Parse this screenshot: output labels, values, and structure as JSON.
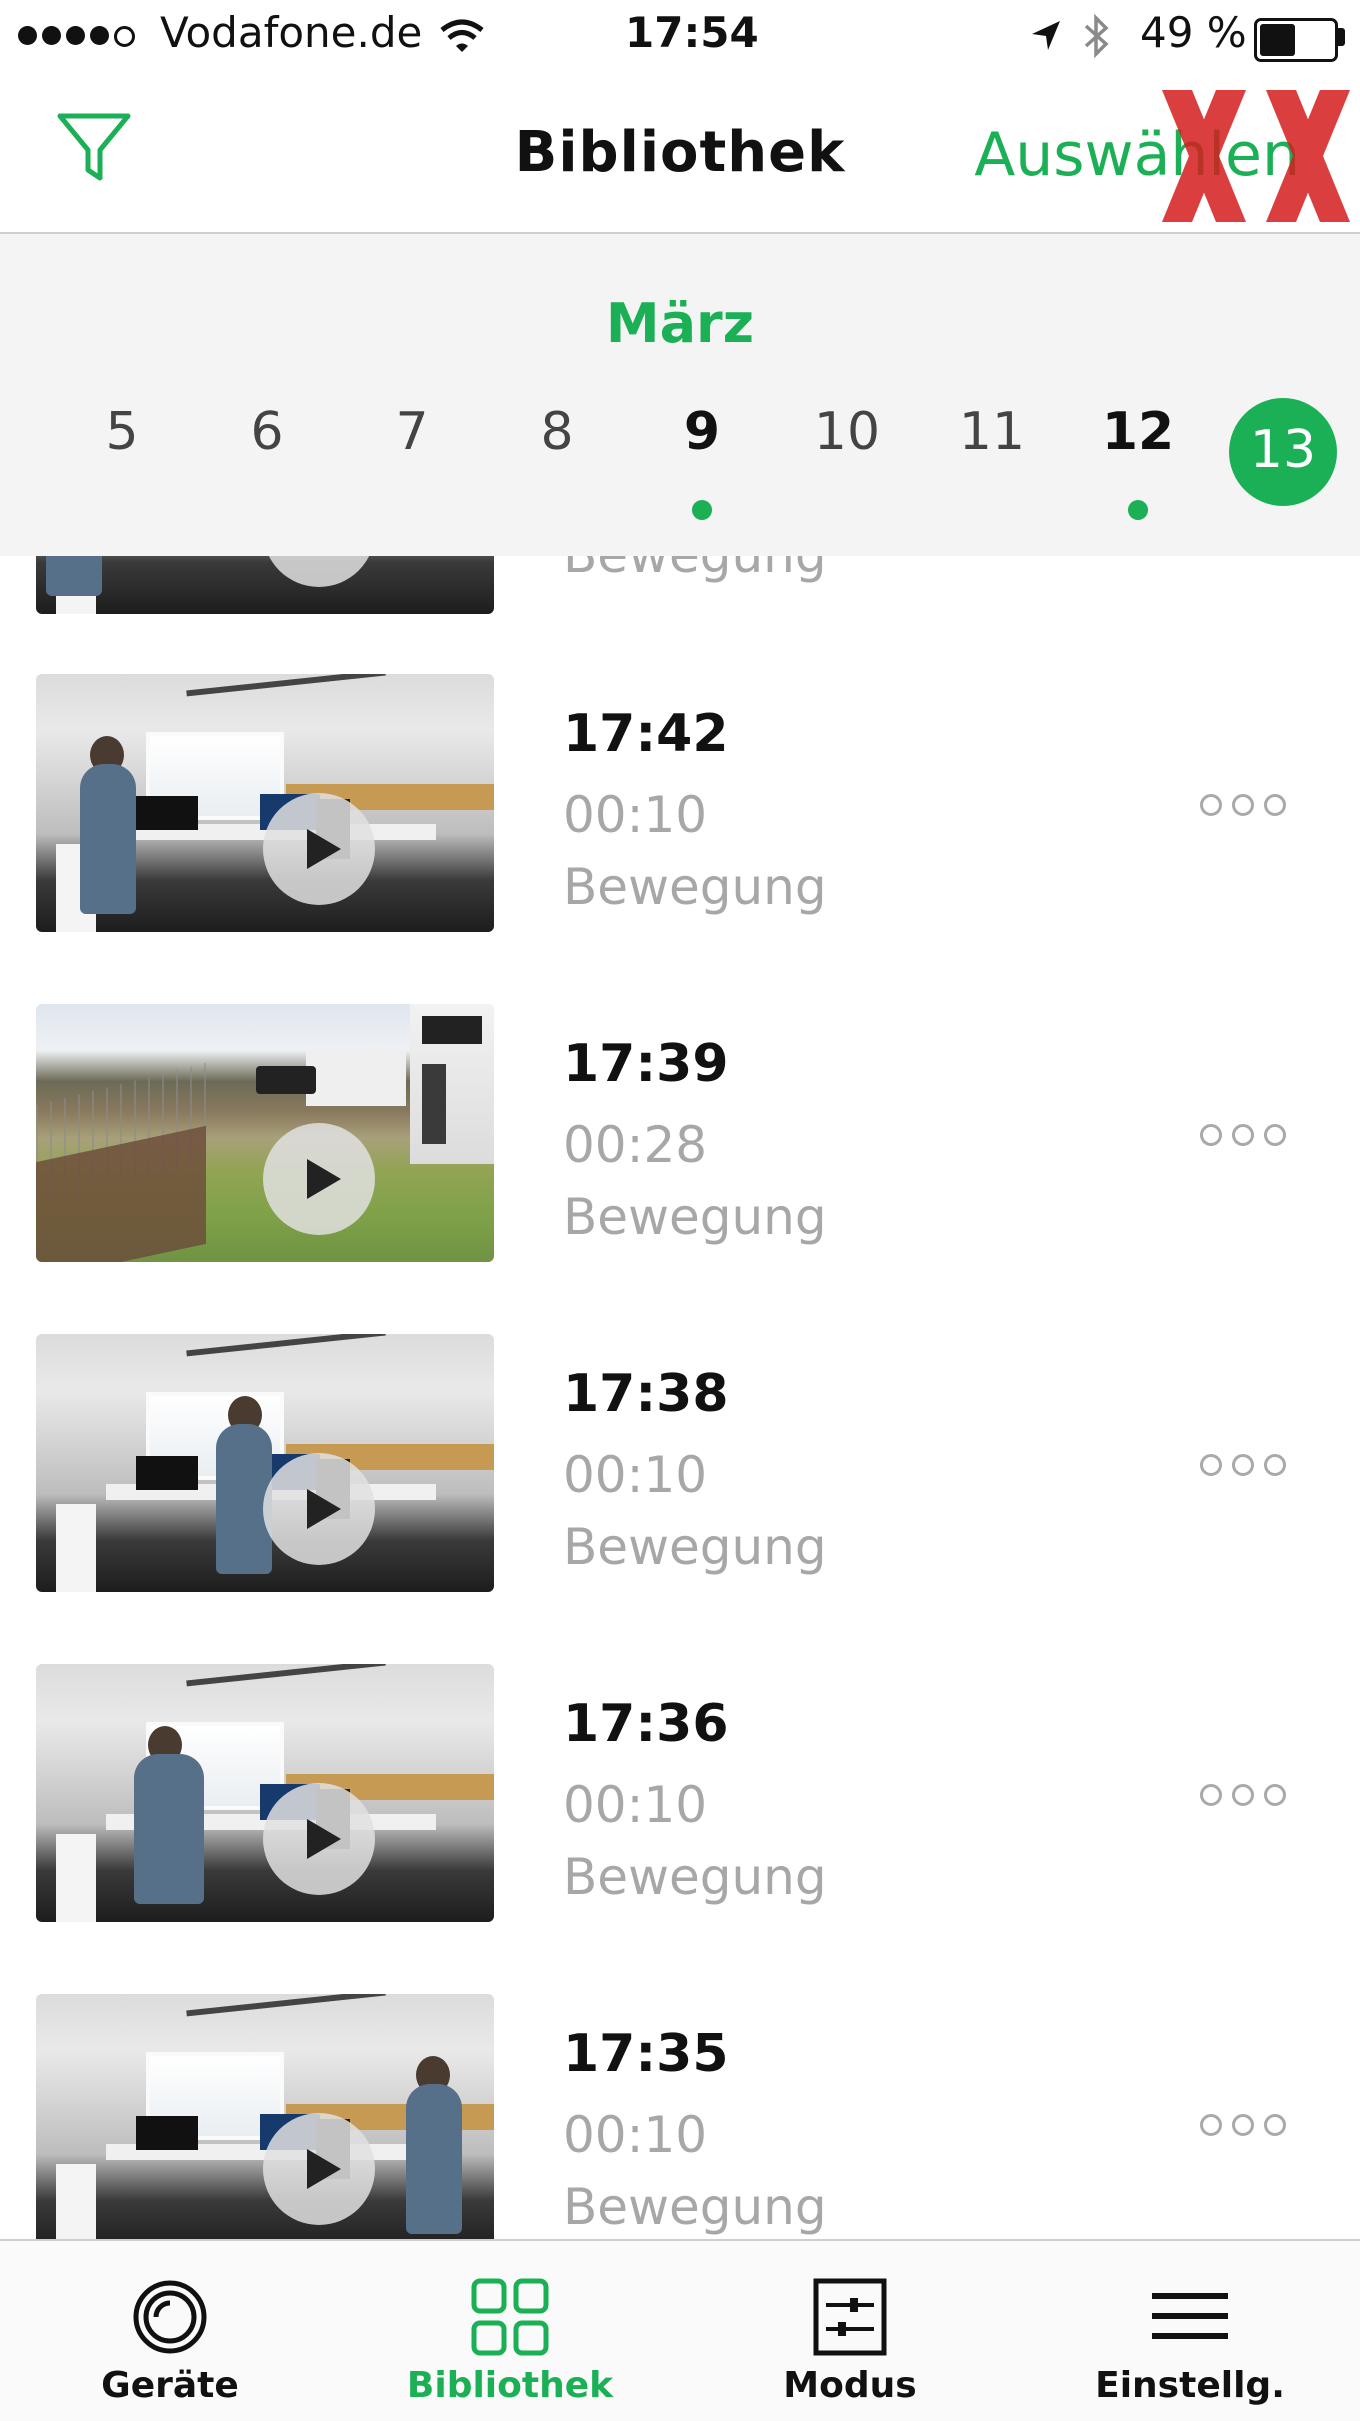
{
  "status_bar": {
    "carrier": "Vodafone.de",
    "time": "17:54",
    "battery": "49 %",
    "battery_level": 0.49,
    "signal_bars": 4,
    "signal_max": 5
  },
  "navbar": {
    "title": "Bibliothek",
    "select_label": "Auswählen",
    "icons": [
      "filter-icon"
    ]
  },
  "calendar": {
    "month": "März",
    "days": [
      {
        "label": "5"
      },
      {
        "label": "6"
      },
      {
        "label": "7"
      },
      {
        "label": "8"
      },
      {
        "label": "9",
        "has_events": true
      },
      {
        "label": "10"
      },
      {
        "label": "11"
      },
      {
        "label": "12",
        "has_events": true
      },
      {
        "label": "13",
        "selected": true
      }
    ]
  },
  "clips": [
    {
      "time": "",
      "duration": "",
      "type": "Bewegung",
      "scene": "office"
    },
    {
      "time": "17:42",
      "duration": "00:10",
      "type": "Bewegung",
      "scene": "office"
    },
    {
      "time": "17:39",
      "duration": "00:28",
      "type": "Bewegung",
      "scene": "garden"
    },
    {
      "time": "17:38",
      "duration": "00:10",
      "type": "Bewegung",
      "scene": "office"
    },
    {
      "time": "17:36",
      "duration": "00:10",
      "type": "Bewegung",
      "scene": "office"
    },
    {
      "time": "17:35",
      "duration": "00:10",
      "type": "Bewegung",
      "scene": "office"
    }
  ],
  "tabs": [
    {
      "label": "Geräte",
      "icon": "camera-lens-icon"
    },
    {
      "label": "Bibliothek",
      "icon": "grid-icon",
      "active": true
    },
    {
      "label": "Modus",
      "icon": "sliders-icon"
    },
    {
      "label": "Einstellg.",
      "icon": "menu-icon"
    }
  ],
  "colors": {
    "accent": "#1bb055",
    "muted_text": "#a7a7a7",
    "date_strip_bg": "#f4f4f4",
    "tabbar_bg": "#fafafa"
  }
}
